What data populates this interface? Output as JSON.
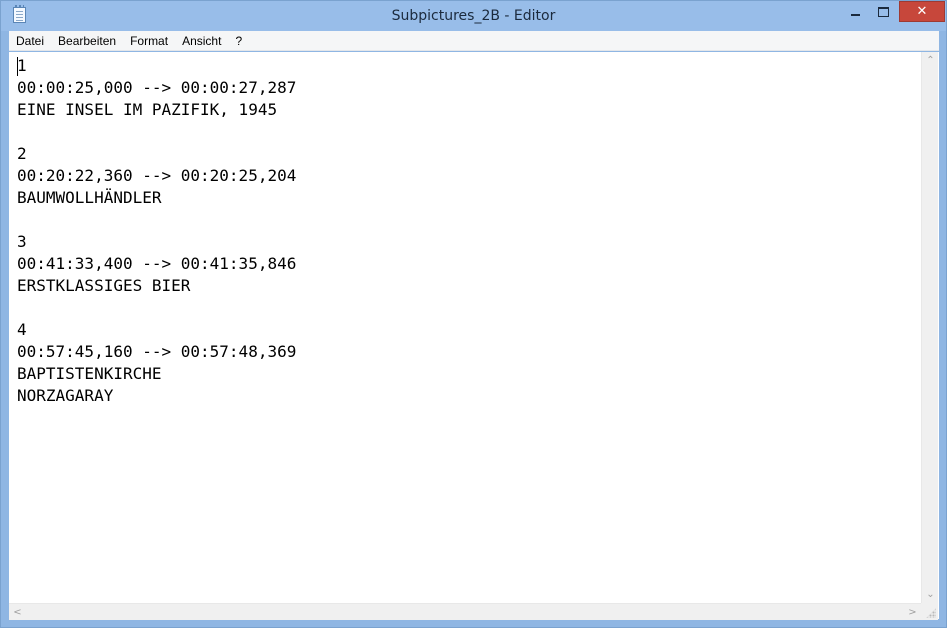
{
  "window": {
    "title": "Subpictures_2B - Editor",
    "close_glyph": "✕"
  },
  "menu": {
    "items": [
      "Datei",
      "Bearbeiten",
      "Format",
      "Ansicht",
      "?"
    ]
  },
  "document": {
    "text": "1\n00:00:25,000 --> 00:00:27,287\nEINE INSEL IM PAZIFIK, 1945\n\n2\n00:20:22,360 --> 00:20:25,204\nBAUMWOLLHÄNDLER\n\n3\n00:41:33,400 --> 00:41:35,846\nERSTKLASSIGES BIER\n\n4\n00:57:45,160 --> 00:57:48,369\nBAPTISTENKIRCHE\nNORZAGARAY"
  },
  "scrollbars": {
    "up": "⌃",
    "down": "⌄",
    "left": "<",
    "right": ">"
  },
  "icons": {
    "app": "notepad-icon",
    "minimize": "minimize-icon",
    "maximize": "maximize-icon",
    "close": "close-icon"
  },
  "colors": {
    "titlebar": "#98bde9",
    "close_button": "#c7473b"
  }
}
